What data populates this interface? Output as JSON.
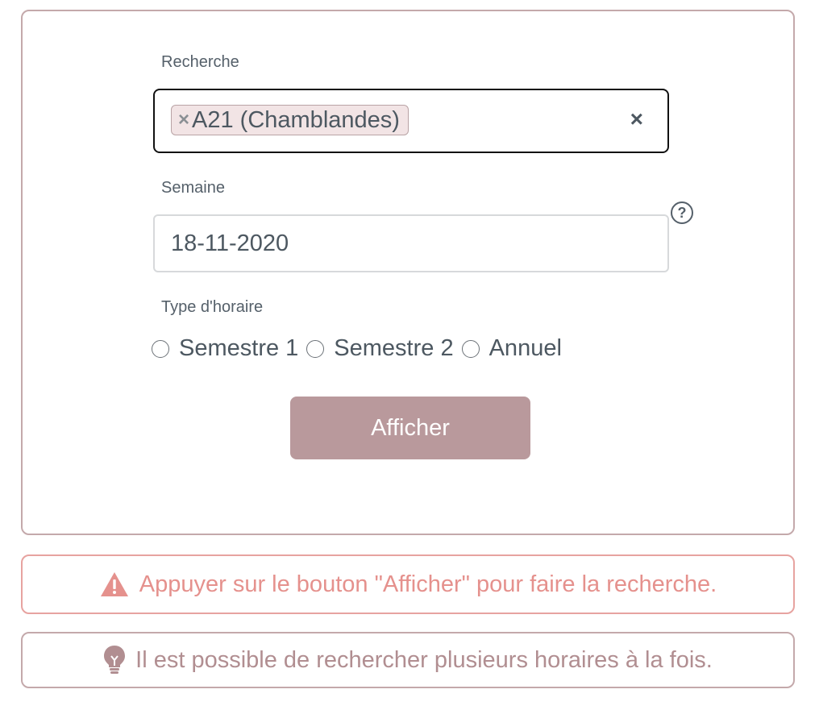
{
  "form": {
    "search": {
      "label": "Recherche",
      "tag_remove": "×",
      "tag_value": "A21 (Chamblandes)",
      "clear": "×"
    },
    "week": {
      "label": "Semaine",
      "value": "18-11-2020",
      "help": "?"
    },
    "schedule_type": {
      "label": "Type d'horaire",
      "options": [
        "Semestre 1",
        "Semestre 2",
        "Annuel"
      ]
    },
    "submit_label": "Afficher"
  },
  "alerts": {
    "warning": "Appuyer sur le bouton \"Afficher\" pour faire la recherche.",
    "tip": "Il est possible de rechercher plusieurs horaires à la fois."
  },
  "colors": {
    "accent": "#b9999c",
    "card_border": "#c4a9ab",
    "warning": "#e5918d",
    "tip": "#b18e91"
  }
}
